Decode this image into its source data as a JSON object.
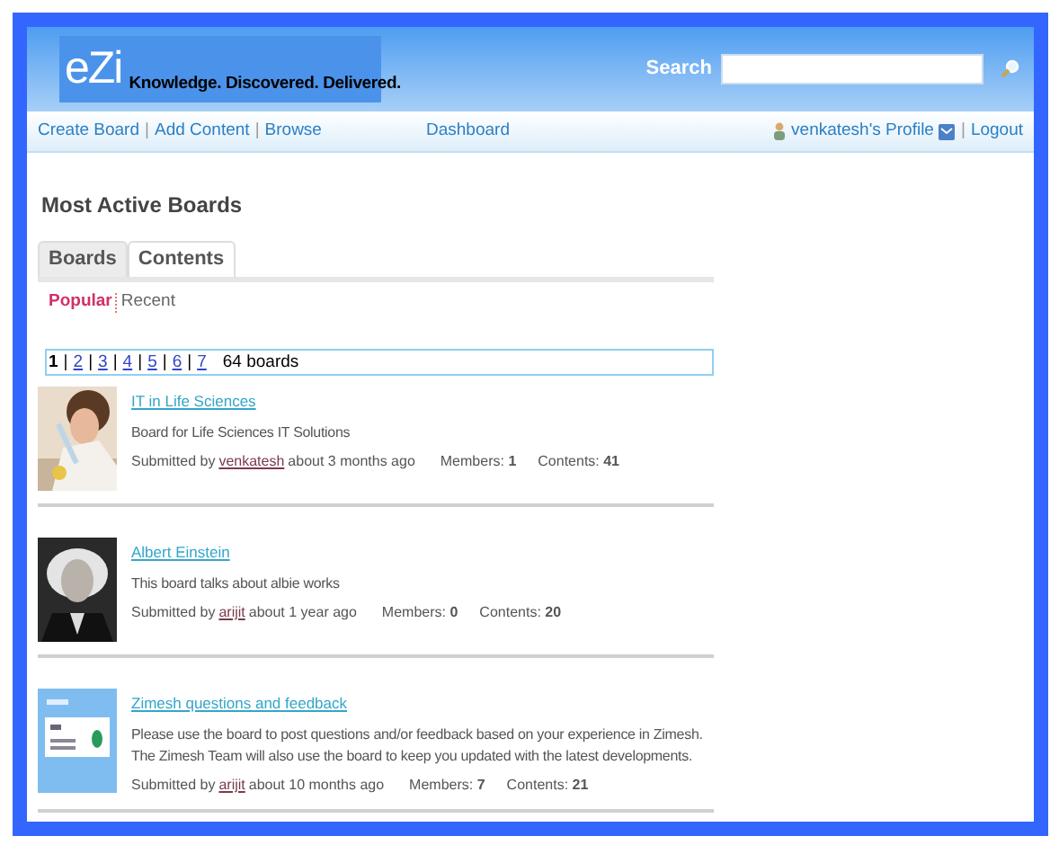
{
  "header": {
    "logo": "eZi",
    "tagline": "Knowledge. Discovered. Delivered.",
    "search_label": "Search"
  },
  "nav": {
    "left": [
      {
        "kind": "link",
        "text": "Create Board"
      },
      {
        "kind": "separator",
        "text": "|"
      },
      {
        "kind": "link",
        "text": "Add Content"
      },
      {
        "kind": "separator",
        "text": "|"
      },
      {
        "kind": "link",
        "text": "Browse"
      }
    ],
    "center": "Dashboard",
    "profile": "venkatesh's Profile",
    "divider": "|",
    "logout": "Logout"
  },
  "heading": "Most Active Boards",
  "tabs": [
    {
      "label": "Boards",
      "selected": true
    },
    {
      "label": "Contents",
      "selected": false
    }
  ],
  "filters": [
    {
      "label": "Popular",
      "selected": true
    },
    {
      "label": "Recent",
      "selected": false
    }
  ],
  "pages": [
    {
      "kind": "page",
      "label": "1",
      "selected": true
    },
    {
      "kind": "separator",
      "label": "|"
    },
    {
      "kind": "page",
      "label": "2",
      "selected": false
    },
    {
      "kind": "separator",
      "label": "|"
    },
    {
      "kind": "page",
      "label": "3",
      "selected": false
    },
    {
      "kind": "separator",
      "label": "|"
    },
    {
      "kind": "page",
      "label": "4",
      "selected": false
    },
    {
      "kind": "separator",
      "label": "|"
    },
    {
      "kind": "page",
      "label": "5",
      "selected": false
    },
    {
      "kind": "separator",
      "label": "|"
    },
    {
      "kind": "page",
      "label": "6",
      "selected": false
    },
    {
      "kind": "separator",
      "label": "|"
    },
    {
      "kind": "page",
      "label": "7",
      "selected": false
    }
  ],
  "board_count": "64 boards",
  "boards": [
    {
      "title": "IT in Life Sciences",
      "description": "Board for Life Sciences IT Solutions",
      "submitted_by": "Submitted by",
      "user": "venkatesh",
      "age": "about 3 months ago",
      "members": "Members: **1**",
      "contents": "Contents: **41**"
    },
    {
      "title": "Albert Einstein",
      "description": "This board talks about albie works",
      "submitted_by": "Submitted by",
      "user": "arijit",
      "age": "about 1 year ago",
      "members": "Members: **0**",
      "contents": "Contents: **20**"
    },
    {
      "title": "Zimesh questions and feedback",
      "description": "Please use the board to post questions and/or feedback based on your experience in Zimesh. The Zimesh Team will also use the board to keep you updated with the latest developments.",
      "submitted_by": "Submitted by",
      "user": "arijit",
      "age": "about 10 months ago",
      "members": "Members: **7**",
      "contents": "Contents: **21**"
    }
  ]
}
